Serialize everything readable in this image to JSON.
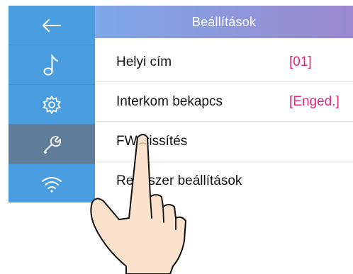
{
  "header": {
    "title": "Beállítások"
  },
  "sidebar": {
    "items": [
      {
        "icon": "back-arrow-icon"
      },
      {
        "icon": "music-note-icon"
      },
      {
        "icon": "gear-icon"
      },
      {
        "icon": "wrench-icon",
        "active": true
      },
      {
        "icon": "wifi-icon"
      }
    ]
  },
  "settings": {
    "rows": [
      {
        "label": "Helyi cím",
        "value": "[01]"
      },
      {
        "label": "Interkom bekapcs",
        "value": "[Enged.]"
      },
      {
        "label": "FW frissítés",
        "value": ""
      },
      {
        "label": "Rendszer beállítások",
        "value": ""
      }
    ]
  },
  "colors": {
    "sidebar": "#4a9ee0",
    "sidebar_active": "#5f7d99",
    "header_start": "#7ea8e6",
    "header_end": "#9b88cf",
    "value_text": "#e0287a"
  }
}
